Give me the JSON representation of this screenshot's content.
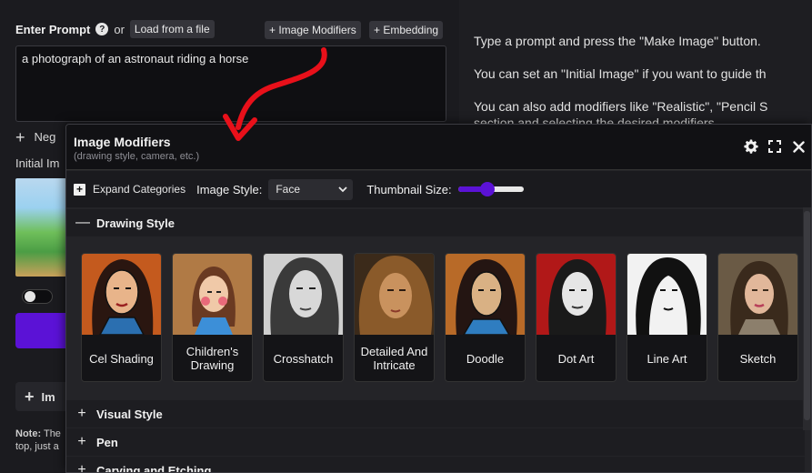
{
  "prompt": {
    "title": "Enter Prompt",
    "help_icon": "?",
    "or_text": "or",
    "load_button": "Load from a file",
    "image_modifiers_button": "+ Image Modifiers",
    "embedding_button": "+ Embedding",
    "value": "a photograph of an astronaut riding a horse"
  },
  "left_partial": {
    "negative_label": "Neg",
    "initial_label": "Initial Im",
    "image_modifiers_label": "Im",
    "note_bold": "Note:",
    "note_text_1": "The",
    "note_text_2": "top, just a"
  },
  "right_help": {
    "line1": "Type a prompt and press the \"Make Image\" button.",
    "line2": "You can set an \"Initial Image\" if you want to guide th",
    "line3": "You can also add modifiers like \"Realistic\", \"Pencil S",
    "line4": "section and selecting the desired modifiers"
  },
  "modal": {
    "title": "Image Modifiers",
    "subtitle": "(drawing style, camera, etc.)",
    "icons": [
      "gear-icon",
      "fullscreen-icon",
      "close-icon"
    ],
    "expand_label": "Expand Categories",
    "style_label": "Image Style:",
    "style_value": "Face",
    "thumb_label": "Thumbnail Size:",
    "thumb_size_fraction": 0.45,
    "categories": [
      {
        "name": "Drawing Style",
        "expanded": true
      },
      {
        "name": "Visual Style",
        "expanded": false
      },
      {
        "name": "Pen",
        "expanded": false
      },
      {
        "name": "Carving and Etching",
        "expanded": false
      }
    ],
    "cards": [
      {
        "label": "Cel Shading"
      },
      {
        "label": "Children's Drawing"
      },
      {
        "label": "Crosshatch"
      },
      {
        "label": "Detailed And Intricate"
      },
      {
        "label": "Doodle"
      },
      {
        "label": "Dot Art"
      },
      {
        "label": "Line Art"
      },
      {
        "label": "Sketch"
      }
    ]
  },
  "colors": {
    "accent": "#5b12d6",
    "annotation_arrow": "#e8101a"
  }
}
